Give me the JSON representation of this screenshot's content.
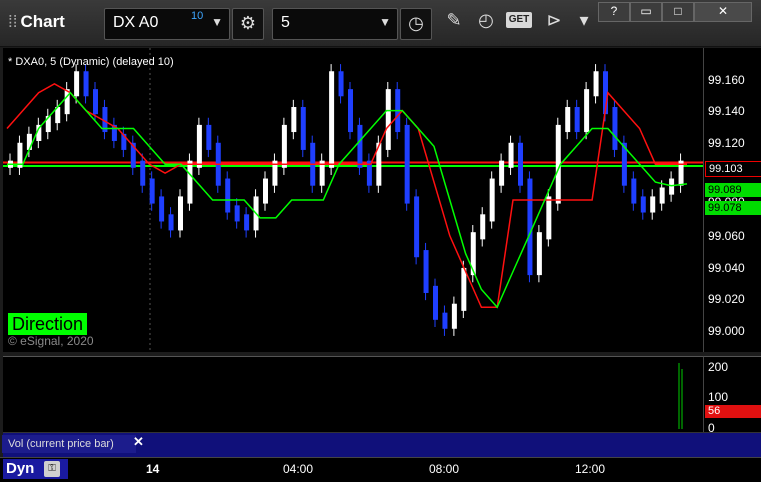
{
  "app": {
    "title": "Chart"
  },
  "toolbar": {
    "symbol": "DX A0",
    "symbol_delay": "10",
    "interval": "5",
    "get_label": "GET"
  },
  "window_buttons": [
    "?",
    "▭",
    "□",
    "✕"
  ],
  "legend": "* DXA0, 5 (Dynamic) (delayed 10)",
  "overlay": {
    "direction": "Direction",
    "copyright": "© eSignal, 2020"
  },
  "price_axis": {
    "ticks": [
      "99.160",
      "99.140",
      "99.120",
      "99.100",
      "99.080",
      "99.060",
      "99.040",
      "99.020",
      "99.000"
    ],
    "current": "99.103",
    "green_high": "99.089",
    "green_low": "99.078"
  },
  "volume_axis": {
    "ticks": [
      "200",
      "100",
      "0"
    ],
    "current": "56"
  },
  "panel": {
    "label": "Vol (current price bar)",
    "close": "✕"
  },
  "time_axis": {
    "dyn": "Dyn",
    "labels": [
      "14",
      "04:00",
      "08:00",
      "12:00"
    ]
  },
  "colors": {
    "up_candle": "#ffffff",
    "down_candle": "#1f3fff",
    "red_line": "#ff1010",
    "green_line": "#00ff00"
  },
  "chart_data": {
    "type": "line",
    "ylim": [
      98.995,
      99.165
    ],
    "red_line": [
      99.12,
      99.13,
      99.14,
      99.145,
      99.14,
      99.13,
      99.125,
      99.12,
      99.11,
      99.1,
      99.095,
      99.1,
      99.1,
      99.1,
      99.1,
      99.1,
      99.1,
      99.1,
      99.1,
      99.1,
      99.1,
      99.1,
      99.1,
      99.1,
      99.12,
      99.13,
      99.12,
      99.09,
      99.06,
      99.04,
      99.02,
      99.02,
      99.08,
      99.08,
      99.08,
      99.08,
      99.08,
      99.08,
      99.14,
      99.13,
      99.12,
      99.1,
      99.1,
      99.1
    ],
    "green_line": [
      99.1,
      99.1,
      99.12,
      99.13,
      99.14,
      99.13,
      99.12,
      99.12,
      99.12,
      99.11,
      99.1,
      99.1,
      99.09,
      99.08,
      99.08,
      99.08,
      99.07,
      99.07,
      99.08,
      99.08,
      99.08,
      99.1,
      99.11,
      99.12,
      99.13,
      99.13,
      99.12,
      99.11,
      99.08,
      99.05,
      99.03,
      99.02,
      99.04,
      99.06,
      99.08,
      99.1,
      99.11,
      99.12,
      99.12,
      99.11,
      99.1,
      99.09,
      99.088,
      99.089
    ]
  }
}
